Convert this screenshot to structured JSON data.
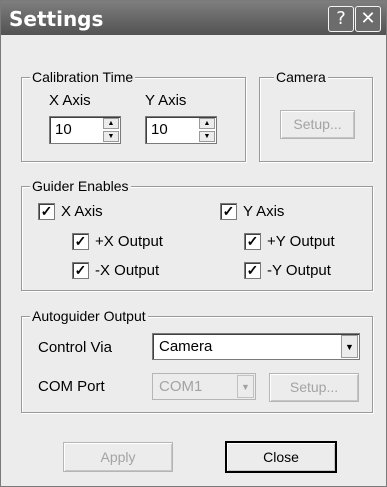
{
  "window": {
    "title": "Settings",
    "help_glyph": "?",
    "close_glyph": "✕"
  },
  "calibration": {
    "group_label": "Calibration Time",
    "x_label": "X Axis",
    "x_value": "10",
    "y_label": "Y Axis",
    "y_value": "10"
  },
  "camera": {
    "group_label": "Camera",
    "setup_label": "Setup..."
  },
  "guider_enables": {
    "group_label": "Guider Enables",
    "x_axis": {
      "label": "X Axis",
      "checked": true
    },
    "y_axis": {
      "label": "Y Axis",
      "checked": true
    },
    "x_plus": {
      "label": "+X Output",
      "checked": true
    },
    "y_plus": {
      "label": "+Y Output",
      "checked": true
    },
    "x_minus": {
      "label": "-X Output",
      "checked": true
    },
    "y_minus": {
      "label": "-Y Output",
      "checked": true
    }
  },
  "autoguider": {
    "group_label": "Autoguider Output",
    "control_label": "Control Via",
    "control_value": "Camera",
    "com_label": "COM Port",
    "com_value": "COM1",
    "setup_label": "Setup..."
  },
  "footer": {
    "apply_label": "Apply",
    "close_label": "Close"
  },
  "glyphs": {
    "check": "✓",
    "up": "▲",
    "down": "▼"
  }
}
